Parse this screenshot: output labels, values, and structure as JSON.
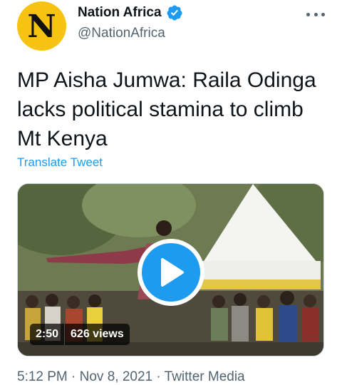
{
  "account": {
    "display_name": "Nation Africa",
    "handle": "@NationAfrica",
    "avatar_letter": "N",
    "avatar_color": "#f7c313",
    "verified": true
  },
  "tweet": {
    "text": "MP Aisha Jumwa: Raila Odinga lacks political stamina to climb Mt Kenya",
    "translate_label": "Translate Tweet"
  },
  "media": {
    "duration": "2:50",
    "views": "626 views"
  },
  "footer": {
    "meta": "5:12 PM · Nov 8, 2021 · Twitter Media"
  },
  "colors": {
    "accent": "#1d9bf0",
    "secondary_text": "#536471",
    "primary_text": "#0f1419"
  },
  "icons": {
    "verified": "verified-badge-icon",
    "more": "more-options-icon",
    "play": "play-icon"
  }
}
